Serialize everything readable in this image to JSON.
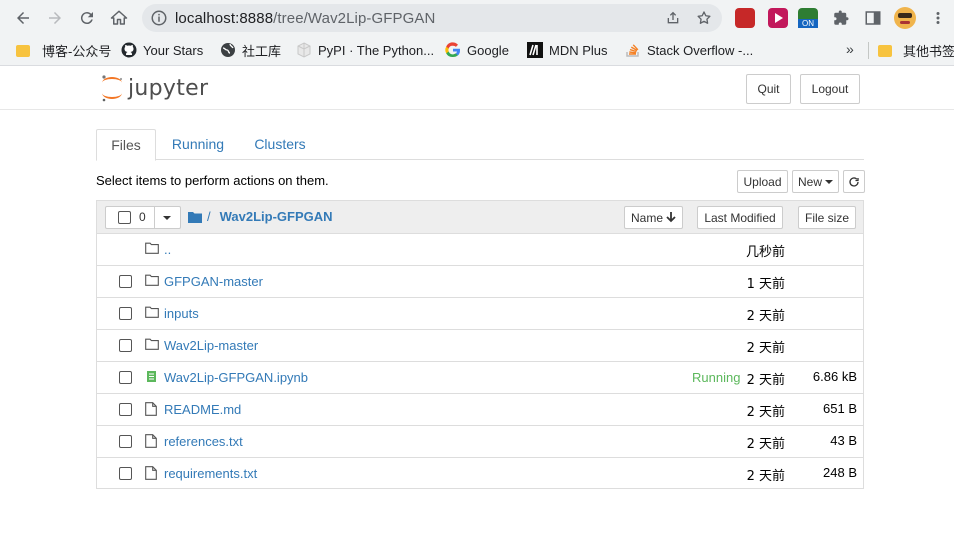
{
  "browser": {
    "url_host": "localhost:8888",
    "url_path": "/tree/Wav2Lip-GFPGAN",
    "ext_badge": "ON",
    "bookmarks": [
      {
        "label": "博客-公众号",
        "icon": "folder-icon"
      },
      {
        "label": "Your Stars",
        "icon": "github-icon"
      },
      {
        "label": "社工库",
        "icon": "globe-icon"
      },
      {
        "label": "PyPI · The Python...",
        "icon": "pypi-icon"
      },
      {
        "label": "Google",
        "icon": "google-icon"
      },
      {
        "label": "MDN Plus",
        "icon": "mdn-icon"
      },
      {
        "label": "Stack Overflow -...",
        "icon": "stackoverflow-icon"
      }
    ],
    "more_bookmarks": "»",
    "other_bookmarks": "其他书签"
  },
  "header": {
    "logo_text": "jupyter",
    "quit_label": "Quit",
    "logout_label": "Logout"
  },
  "tabs": [
    {
      "label": "Files",
      "active": true
    },
    {
      "label": "Running",
      "active": false
    },
    {
      "label": "Clusters",
      "active": false
    }
  ],
  "toolbar": {
    "hint": "Select items to perform actions on them.",
    "upload_label": "Upload",
    "new_label": "New"
  },
  "list_header": {
    "selected_count": "0",
    "crumb_root": "/",
    "crumb_folder": "Wav2Lip-GFPGAN",
    "name_label": "Name",
    "last_modified_label": "Last Modified",
    "file_size_label": "File size"
  },
  "items": [
    {
      "name": "..",
      "type": "parent",
      "status": "",
      "modified": "几秒前",
      "size": ""
    },
    {
      "name": "GFPGAN-master",
      "type": "folder",
      "status": "",
      "modified": "1 天前",
      "size": ""
    },
    {
      "name": "inputs",
      "type": "folder",
      "status": "",
      "modified": "2 天前",
      "size": ""
    },
    {
      "name": "Wav2Lip-master",
      "type": "folder",
      "status": "",
      "modified": "2 天前",
      "size": ""
    },
    {
      "name": "Wav2Lip-GFPGAN.ipynb",
      "type": "notebook",
      "status": "Running",
      "modified": "2 天前",
      "size": "6.86 kB"
    },
    {
      "name": "README.md",
      "type": "file",
      "status": "",
      "modified": "2 天前",
      "size": "651 B"
    },
    {
      "name": "references.txt",
      "type": "file",
      "status": "",
      "modified": "2 天前",
      "size": "43 B"
    },
    {
      "name": "requirements.txt",
      "type": "file",
      "status": "",
      "modified": "2 天前",
      "size": "248 B"
    }
  ],
  "colors": {
    "link": "#337ab7",
    "running": "#5cb85c",
    "notebook_icon": "#5cb85c",
    "logo_orange": "#f37726"
  }
}
